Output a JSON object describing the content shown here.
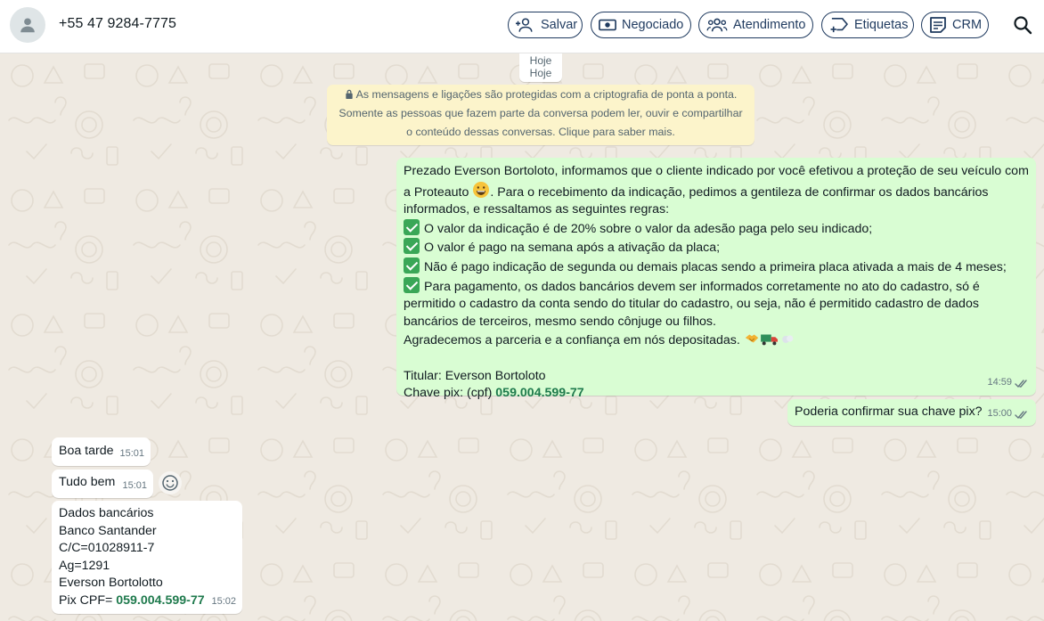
{
  "header": {
    "contact": "+55 47 9284-7775",
    "buttons": {
      "salvar": "Salvar",
      "negociado": "Negociado",
      "atendimento": "Atendimento",
      "etiquetas": "Etiquetas",
      "crm": "CRM"
    },
    "icons": {
      "avatar": "person-icon",
      "salvar": "person-add-icon",
      "negociado": "money-icon",
      "atendimento": "group-icon",
      "etiquetas": "label-add-icon",
      "crm": "note-icon",
      "search": "search-icon"
    }
  },
  "chat": {
    "date_chip": [
      "Hoje",
      "Hoje"
    ],
    "encryption_notice": [
      "As mensagens e ligações são protegidas com a criptografia de ponta a ponta.",
      "Somente as pessoas que fazem parte da conversa podem ler, ouvir e compartilhar",
      "o conteúdo dessas conversas. Clique para saber mais."
    ],
    "out_messages": [
      {
        "lines": {
          "l1": "Prezado Everson Bortoloto, informamos que o cliente indicado por você efetivou a proteção de seu veículo com",
          "l2a": "a Proteauto",
          "l2b": ". Para o recebimento da indicação, pedimos a gentileza de confirmar os dados bancários",
          "l3": "informados, e  ressaltamos as seguintes regras:",
          "l4": "O valor da indicação é de 20% sobre o valor da adesão paga pelo seu indicado;",
          "l5": "O valor é pago na semana após a ativação da placa;",
          "l6": "Não é pago indicação de segunda ou demais placas sendo a primeira placa ativada a mais de 4 meses;",
          "l7": "Para pagamento, os dados bancários devem ser informados corretamente no ato do cadastro, só é",
          "l8": "permitido o cadastro da conta sendo do titular do cadastro, ou seja, não é permitido cadastro de dados",
          "l9": "bancários de terceiros, mesmo sendo cônjuge ou filhos.",
          "l10": "Agradecemos a parceria e a confiança em nós depositadas.",
          "l11": "Titular: Everson Bortoloto",
          "l12a": "Chave pix: (cpf) ",
          "l12b": "059.004.599-77"
        },
        "time": "14:59",
        "status": "double-check-icon"
      },
      {
        "text": "Poderia confirmar sua chave pix?",
        "time": "15:00",
        "status": "double-check-icon"
      }
    ],
    "in_messages": [
      {
        "text": "Boa tarde",
        "time": "15:01"
      },
      {
        "text": "Tudo bem",
        "time": "15:01"
      },
      {
        "lines": {
          "l1": "Dados bancários",
          "l2": "Banco Santander",
          "l3": "C/C=01028911-7",
          "l4": "Ag=1291",
          "l5": "Everson Bortolotto",
          "l6a": "Pix CPF= ",
          "l6b": "059.004.599-77"
        },
        "time": "15:02"
      }
    ]
  },
  "colors": {
    "chat_background": "#efeae2",
    "outgoing_bubble": "#d9fdd3",
    "incoming_bubble": "#ffffff",
    "notice_background": "#fcf4cb",
    "header_button_border": "#1f3a5f",
    "pix_highlight": "#1f7a4d"
  }
}
